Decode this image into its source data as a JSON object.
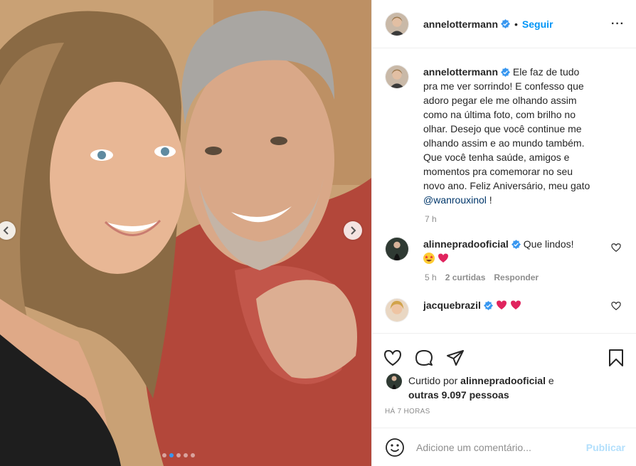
{
  "post": {
    "author": "annelottermann",
    "follow_label": "Seguir",
    "separator": "•",
    "more_label": "···",
    "caption_text": "Ele faz de tudo pra me ver sorrindo! E confesso que adoro pegar ele me olhando assim como na última foto, com brilho no olhar. Desejo que você continue me olhando assim e ao mundo também. Que você tenha saúde, amigos e momentos pra comemorar no seu novo ano. Feliz Aniversário, meu gato ",
    "caption_mention": "@wanrouxinol",
    "caption_end": " !",
    "caption_time": "7 h",
    "carousel": {
      "total_slides": 5,
      "active_slide": 2
    }
  },
  "comments": [
    {
      "user": "alinnepradooficial",
      "text": "Que lindos!",
      "emojis": [
        "star-struck-emoji",
        "red-heart-emoji"
      ],
      "time": "5 h",
      "likes": "2 curtidas",
      "reply": "Responder"
    },
    {
      "user": "jacquebrazil",
      "text": "",
      "emojis": [
        "red-heart-emoji",
        "red-heart-emoji"
      ]
    }
  ],
  "likes": {
    "prefix": "Curtido por",
    "user": "alinnepradooficial",
    "and": "e",
    "others": "outras 9.097 pessoas"
  },
  "timestamp": "HÁ 7 HORAS",
  "add_comment": {
    "placeholder": "Adicione um comentário...",
    "publish_label": "Publicar"
  },
  "colors": {
    "accent": "#0095f6",
    "verified": "#3897f0",
    "publish_disabled": "#b2dffc",
    "muted": "#8e8e8e"
  }
}
